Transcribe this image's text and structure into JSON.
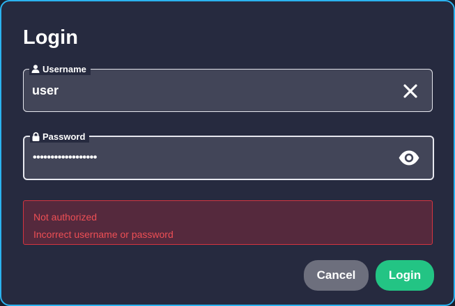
{
  "dialog": {
    "title": "Login"
  },
  "username": {
    "label": "Username",
    "value": "user",
    "icon": "person-icon",
    "action_icon": "clear-icon"
  },
  "password": {
    "label": "Password",
    "masked_value": "••••••••••••••••••",
    "icon": "lock-icon",
    "action_icon": "eye-icon"
  },
  "alert": {
    "title": "Not authorized",
    "message": "Incorrect username or password"
  },
  "buttons": {
    "cancel": "Cancel",
    "login": "Login"
  },
  "colors": {
    "accent_border": "#2bb3f0",
    "dialog_bg": "#262a3f",
    "field_bg": "#424558",
    "error": "#ee4f55",
    "error_bg": "#55293d",
    "cancel_bg": "#6d6f7d",
    "login_bg": "#23c484"
  }
}
